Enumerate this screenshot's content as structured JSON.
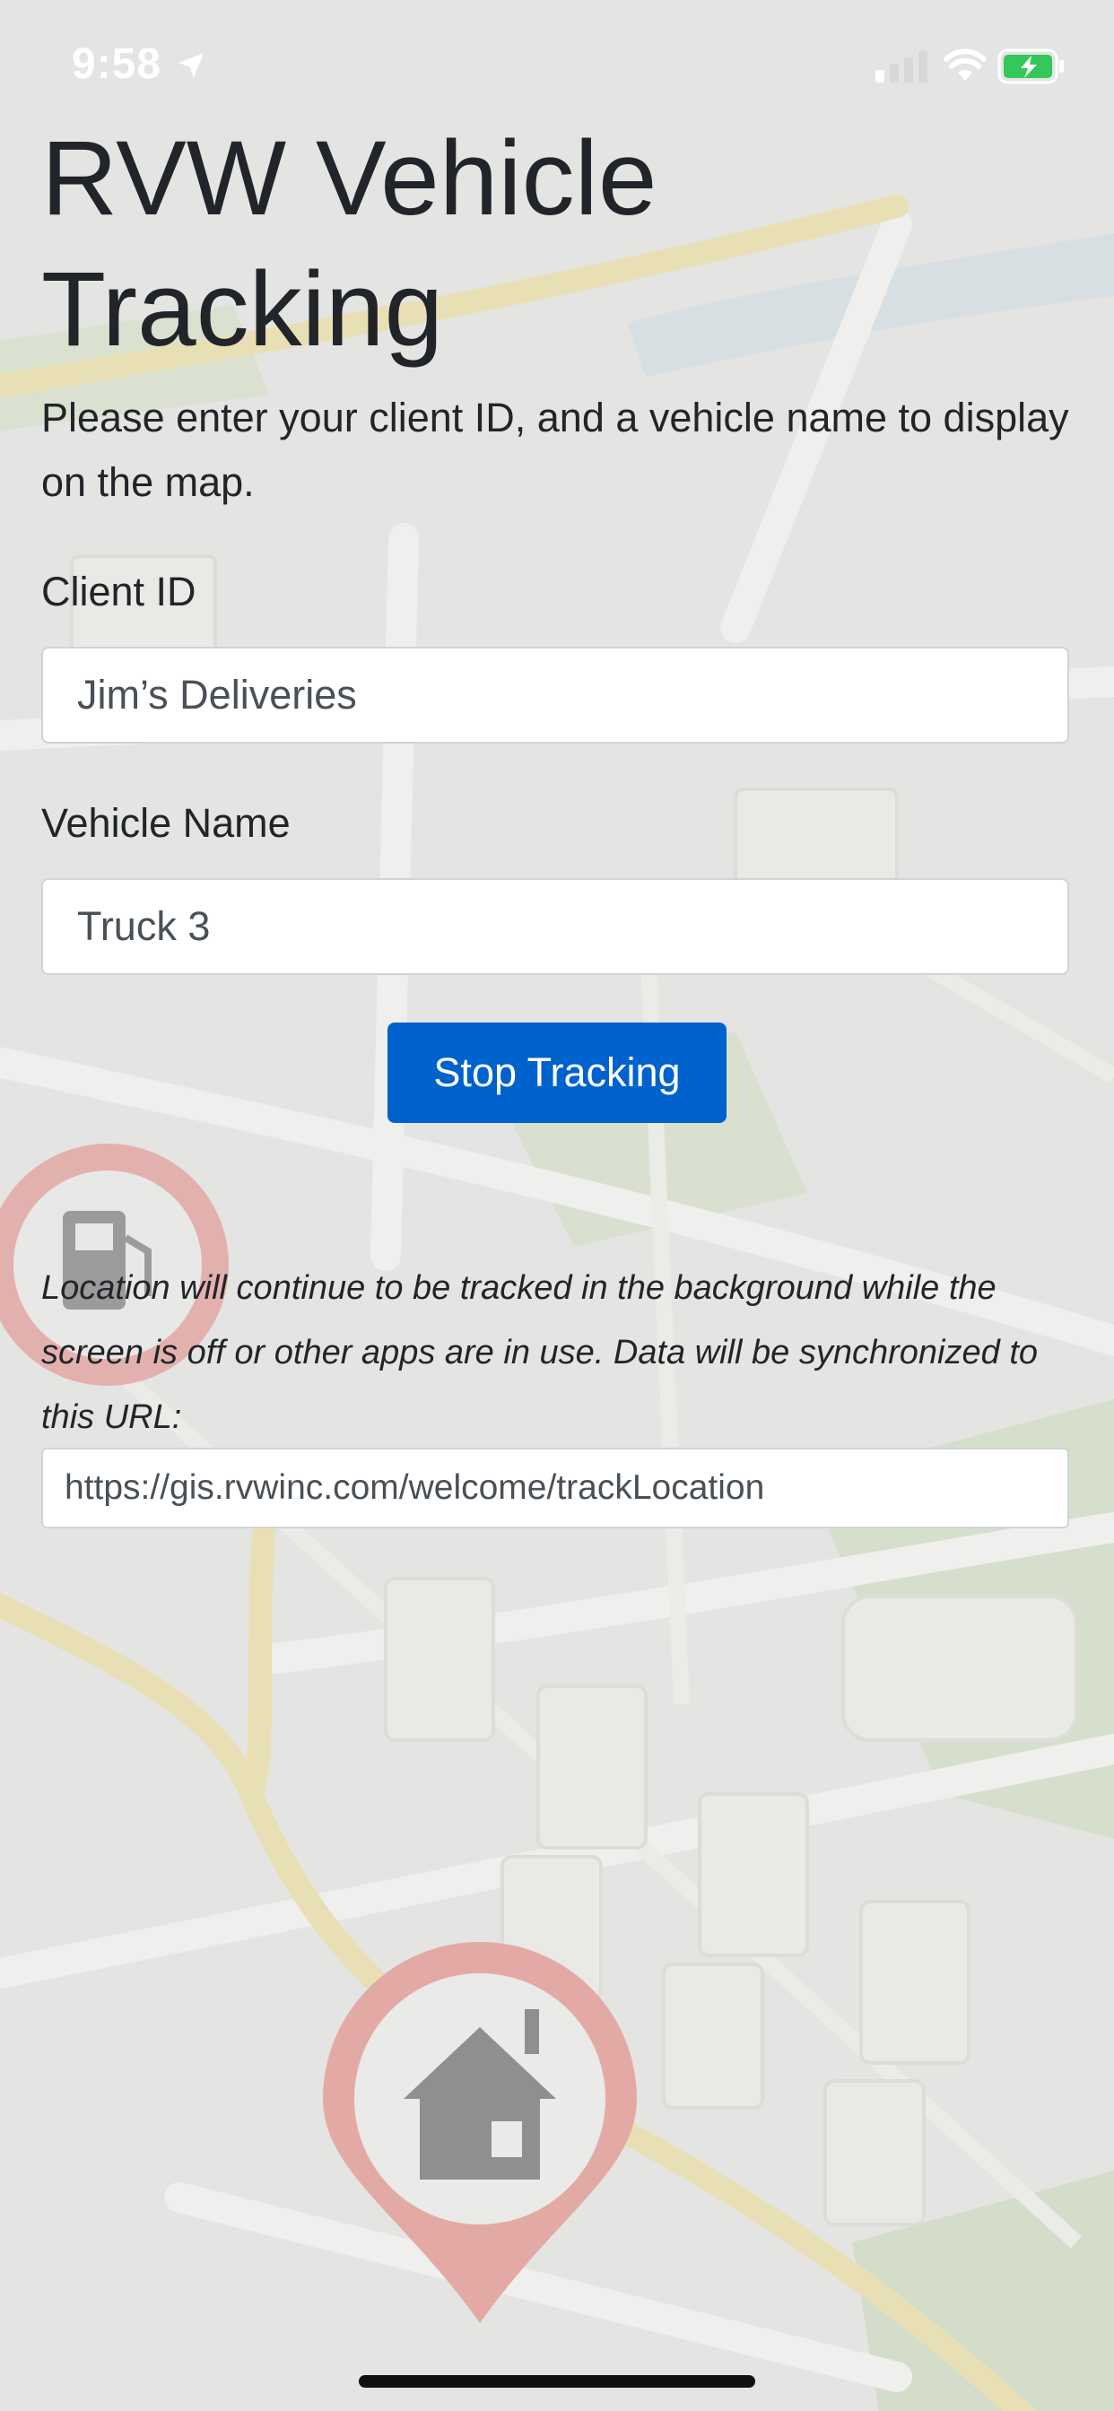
{
  "status_bar": {
    "time": "9:58",
    "battery_color": "#34c759",
    "location_icon": "location-arrow-icon",
    "signal_icon": "cellular-signal-icon",
    "wifi_icon": "wifi-icon",
    "battery_icon": "battery-charging-icon"
  },
  "page": {
    "title": "RVW Vehicle Tracking",
    "intro": "Please enter your client ID, and a vehicle name to display on the map.",
    "background_icons": [
      "map-background",
      "fuel-pin-icon",
      "home-pin-icon"
    ]
  },
  "form": {
    "client_id_label": "Client ID",
    "client_id_value": "Jim’s Deliveries",
    "vehicle_name_label": "Vehicle Name",
    "vehicle_name_value": "Truck 3",
    "stop_button_label": "Stop Tracking",
    "button_color": "#0062cc"
  },
  "sync": {
    "note": "Location will continue to be tracked in the background while the screen is off or other apps are in use. Data will be synchronized to this URL:",
    "url": "https://gis.rvwinc.com/welcome/trackLocation"
  }
}
